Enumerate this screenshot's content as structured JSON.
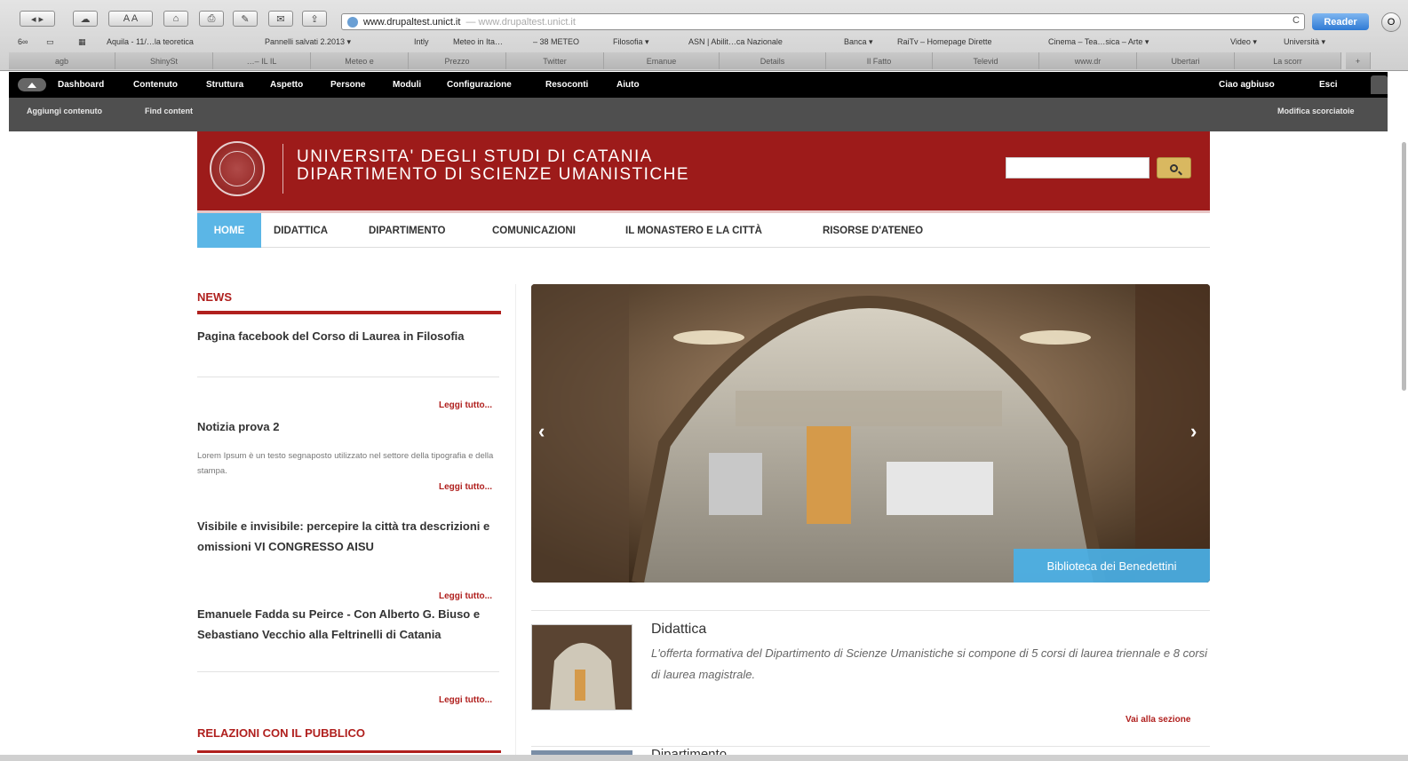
{
  "browser": {
    "url": "www.drupaltest.unict.it",
    "url_dim": "— www.drupaltest.unict.it",
    "reader_label": "Reader",
    "reload_glyph": "C",
    "bookmarks": [
      "Aquila - 11/…la teoretica",
      "Pannelli salvati 2.2013 ▾",
      "Intly",
      "Meteo in Ita…",
      "– 38 METEO",
      "Filosofia ▾",
      "ASN | Abilit…ca Nazionale",
      "Banca ▾",
      "RaiTv – Homepage Dirette",
      "Cinema – Tea…sica – Arte ▾",
      "Video ▾",
      "Università ▾"
    ],
    "tabs": [
      "agb",
      "ShinySt",
      "…– IL IL",
      "Meteo e",
      "Prezzo",
      "Twitter",
      "Emanue",
      "Details",
      "Il Fatto",
      "Televid",
      "www.dr",
      "Ubertari",
      "La scorr"
    ]
  },
  "admin": {
    "menu": [
      "Dashboard",
      "Contenuto",
      "Struttura",
      "Aspetto",
      "Persone",
      "Moduli",
      "Configurazione",
      "Resoconti",
      "Aiuto"
    ],
    "greeting": "Ciao agbiuso",
    "logout": "Esci",
    "shortcuts": [
      "Aggiungi contenuto",
      "Find content"
    ],
    "edit_shortcuts": "Modifica scorciatoie"
  },
  "site": {
    "title_line1": "UNIVERSITA' DEGLI STUDI DI CATANIA",
    "title_line2": "DIPARTIMENTO DI SCIENZE UMANISTICHE",
    "search_placeholder": ""
  },
  "nav": [
    "HOME",
    "DIDATTICA",
    "DIPARTIMENTO",
    "COMUNICAZIONI",
    "IL MONASTERO E LA CITTÀ",
    "RISORSE D'ATENEO"
  ],
  "news": {
    "heading": "NEWS",
    "items": [
      {
        "title": "Pagina facebook del Corso di Laurea in Filosofia",
        "body": "",
        "more": "Leggi tutto..."
      },
      {
        "title": "Notizia prova 2",
        "body": "Lorem Ipsum è un testo segnaposto utilizzato nel settore della tipografia e della stampa.",
        "more": "Leggi tutto..."
      },
      {
        "title": "Visibile e invisibile: percepire la città tra descrizioni e omissioni VI CONGRESSO AISU",
        "body": "",
        "more": "Leggi tutto..."
      },
      {
        "title": "Emanuele Fadda su Peirce - Con Alberto G. Biuso e Sebastiano Vecchio alla Feltrinelli di Catania",
        "body": "",
        "more": "Leggi tutto..."
      }
    ]
  },
  "relazioni": "RELAZIONI CON IL PUBBLICO",
  "slider": {
    "caption": "Biblioteca dei Benedettini",
    "prev": "‹",
    "next": "›"
  },
  "didattica": {
    "title": "Didattica",
    "description": "L'offerta formativa del Dipartimento di Scienze Umanistiche si compone di 5 corsi di laurea triennale e 8 corsi di laurea magistrale.",
    "link": "Vai alla sezione"
  },
  "next_block_title": "Dipartimento",
  "colors": {
    "brand_red": "#9d1b1a",
    "accent_blue": "#5bb6e6",
    "link_red": "#b0201e"
  }
}
